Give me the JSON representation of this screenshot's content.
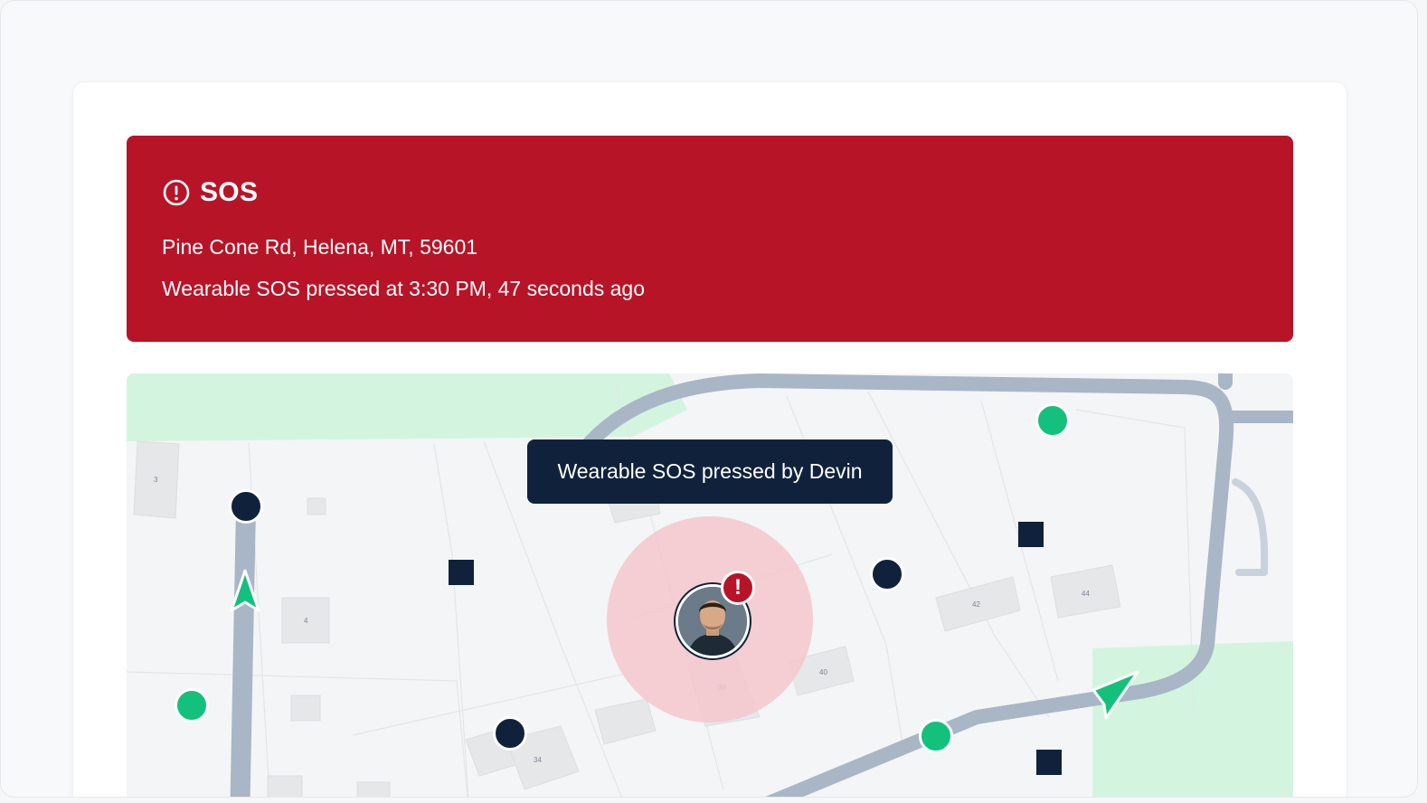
{
  "alert": {
    "title": "SOS",
    "address": "Pine Cone Rd, Helena, MT, 59601",
    "detail": "Wearable SOS pressed at 3:30 PM, 47 seconds ago",
    "icon": "exclamation-circle-icon",
    "color": "#b81427"
  },
  "map": {
    "tooltip": "Wearable SOS pressed by Devin",
    "lot_numbers": [
      "3",
      "4",
      "34",
      "38",
      "40",
      "42",
      "44"
    ],
    "colors": {
      "road": "#a9b6c6",
      "park": "#d3f5df",
      "lot": "#e6e7e9",
      "sos_radius": "#f3c7cc",
      "marker_dark": "#10223b",
      "marker_green": "#13c17c"
    }
  },
  "user": {
    "avatar_icon": "person-avatar",
    "badge": "!"
  }
}
